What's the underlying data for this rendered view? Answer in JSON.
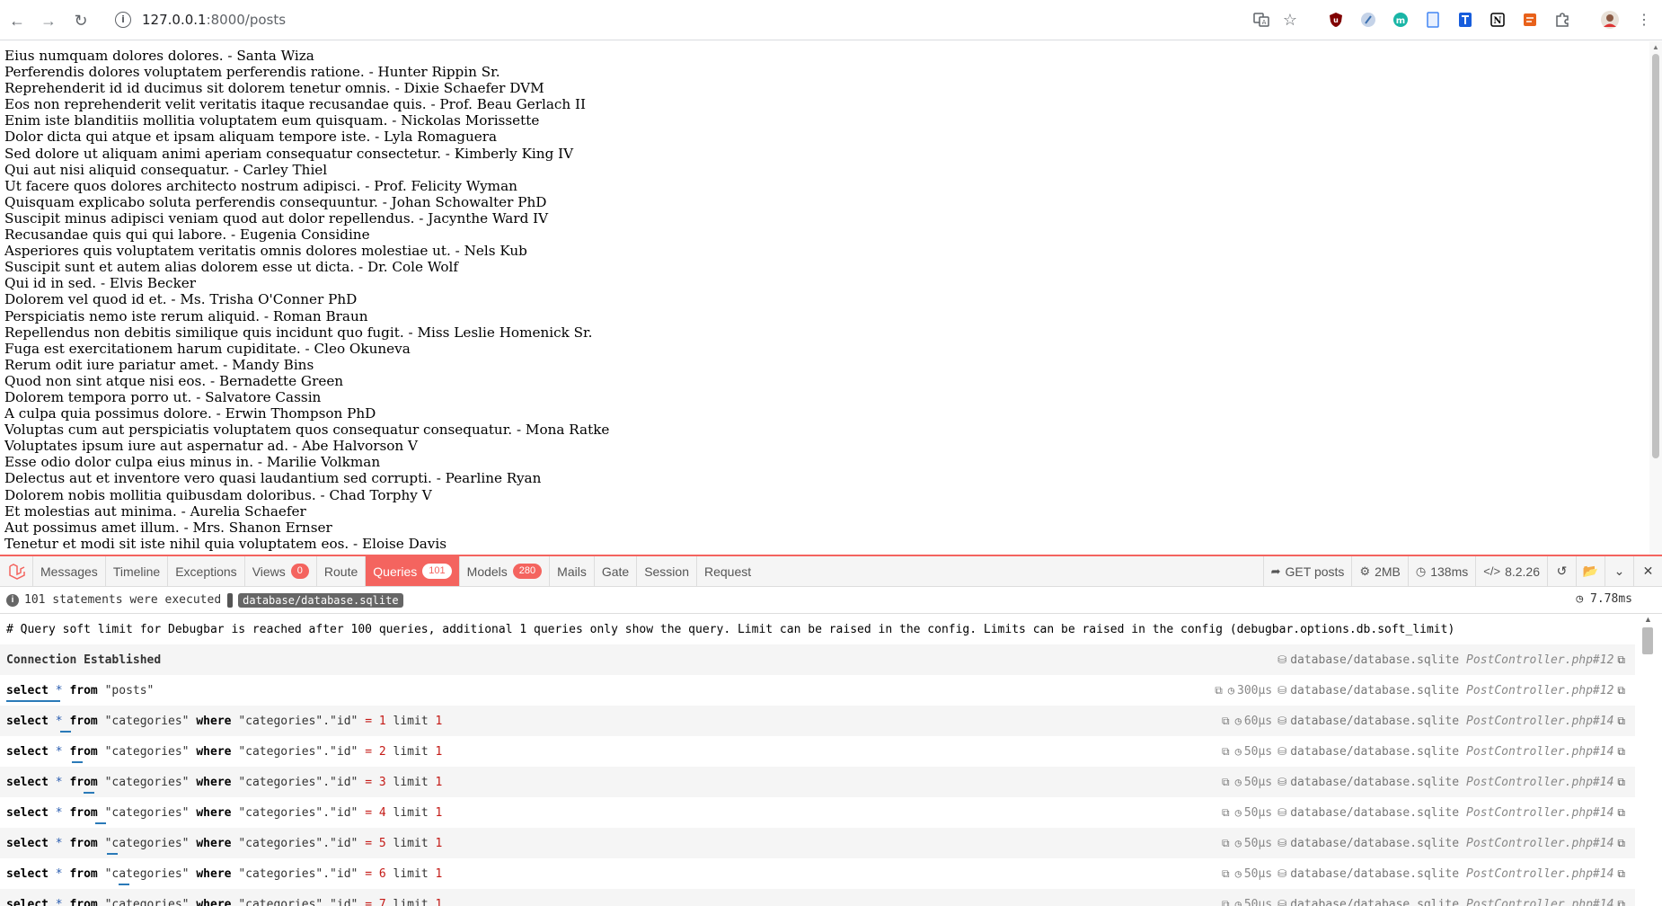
{
  "browser": {
    "url_host": "127.0.0.1",
    "url_path": ":8000/posts"
  },
  "posts": [
    "Eius numquam dolores dolores. - Santa Wiza",
    "Perferendis dolores voluptatem perferendis ratione. - Hunter Rippin Sr.",
    "Reprehenderit id id ducimus sit dolorem tenetur omnis. - Dixie Schaefer DVM",
    "Eos non reprehenderit velit veritatis itaque recusandae quis. - Prof. Beau Gerlach II",
    "Enim iste blanditiis mollitia voluptatem eum quisquam. - Nickolas Morissette",
    "Dolor dicta qui atque et ipsam aliquam tempore iste. - Lyla Romaguera",
    "Sed dolore ut aliquam animi aperiam consequatur consectetur. - Kimberly King IV",
    "Qui aut nisi aliquid consequatur. - Carley Thiel",
    "Ut facere quos dolores architecto nostrum adipisci. - Prof. Felicity Wyman",
    "Quisquam explicabo soluta perferendis consequuntur. - Johan Schowalter PhD",
    "Suscipit minus adipisci veniam quod aut dolor repellendus. - Jacynthe Ward IV",
    "Recusandae quis qui qui labore. - Eugenia Considine",
    "Asperiores quis voluptatem veritatis omnis dolores molestiae ut. - Nels Kub",
    "Suscipit sunt et autem alias dolorem esse ut dicta. - Dr. Cole Wolf",
    "Qui id in sed. - Elvis Becker",
    "Dolorem vel quod id et. - Ms. Trisha O'Conner PhD",
    "Perspiciatis nemo iste rerum aliquid. - Roman Braun",
    "Repellendus non debitis similique quis incidunt quo fugit. - Miss Leslie Homenick Sr.",
    "Fuga est exercitationem harum cupiditate. - Cleo Okuneva",
    "Rerum odit iure pariatur amet. - Mandy Bins",
    "Quod non sint atque nisi eos. - Bernadette Green",
    "Dolorem tempora porro ut. - Salvatore Cassin",
    "A culpa quia possimus dolore. - Erwin Thompson PhD",
    "Voluptas cum aut perspiciatis voluptatem quos consequatur consequatur. - Mona Ratke",
    "Voluptates ipsum iure aut aspernatur ad. - Abe Halvorson V",
    "Esse odio dolor culpa eius minus in. - Marilie Volkman",
    "Delectus aut et inventore vero quasi laudantium sed corrupti. - Pearline Ryan",
    "Dolorem nobis mollitia quibusdam doloribus. - Chad Torphy V",
    "Et molestias aut minima. - Aurelia Schaefer",
    "Aut possimus amet illum. - Mrs. Shanon Ernser",
    "Tenetur et modi sit iste nihil quia voluptatem eos. - Eloise Davis"
  ],
  "debugbar": {
    "tabs": [
      {
        "label": "Messages"
      },
      {
        "label": "Timeline"
      },
      {
        "label": "Exceptions"
      },
      {
        "label": "Views",
        "badge": "0"
      },
      {
        "label": "Route"
      },
      {
        "label": "Queries",
        "badge": "101",
        "active": true
      },
      {
        "label": "Models",
        "badge": "280"
      },
      {
        "label": "Mails"
      },
      {
        "label": "Gate"
      },
      {
        "label": "Session"
      },
      {
        "label": "Request"
      }
    ],
    "indicators": {
      "route": "GET posts",
      "memory": "2MB",
      "time": "138ms",
      "version": "8.2.26"
    },
    "status": {
      "statements": "101 statements were executed",
      "database": "database/database.sqlite",
      "total_time": "7.78ms"
    },
    "soft_limit_comment": "# Query soft limit for Debugbar is reached after 100 queries, additional 1 queries only show the query. Limit can be raised in the config. Limits can be raised in the config (debugbar.options.db.soft_limit)",
    "connection": {
      "label": "Connection Established",
      "db": "database/database.sqlite",
      "source": "PostController.php#12"
    },
    "queries": [
      {
        "table": "\"posts\"",
        "id": null,
        "time": "300μs",
        "db": "database/database.sqlite",
        "source": "PostController.php#12"
      },
      {
        "table": "\"categories\"",
        "id": "1",
        "time": "60μs",
        "db": "database/database.sqlite",
        "source": "PostController.php#14"
      },
      {
        "table": "\"categories\"",
        "id": "2",
        "time": "50μs",
        "db": "database/database.sqlite",
        "source": "PostController.php#14"
      },
      {
        "table": "\"categories\"",
        "id": "3",
        "time": "50μs",
        "db": "database/database.sqlite",
        "source": "PostController.php#14"
      },
      {
        "table": "\"categories\"",
        "id": "4",
        "time": "50μs",
        "db": "database/database.sqlite",
        "source": "PostController.php#14"
      },
      {
        "table": "\"categories\"",
        "id": "5",
        "time": "50μs",
        "db": "database/database.sqlite",
        "source": "PostController.php#14"
      },
      {
        "table": "\"categories\"",
        "id": "6",
        "time": "50μs",
        "db": "database/database.sqlite",
        "source": "PostController.php#14"
      },
      {
        "table": "\"categories\"",
        "id": "7",
        "time": "50μs",
        "db": "database/database.sqlite",
        "source": "PostController.php#14"
      }
    ],
    "sql": {
      "select": "select",
      "star": "*",
      "from": "from",
      "where": "where",
      "column": "\"categories\".\"id\"",
      "eq": "=",
      "limit": "limit",
      "limit_val": "1"
    }
  },
  "colors": {
    "accent": "#f4645f",
    "keyword": "#000000",
    "number": "#c41a16"
  }
}
